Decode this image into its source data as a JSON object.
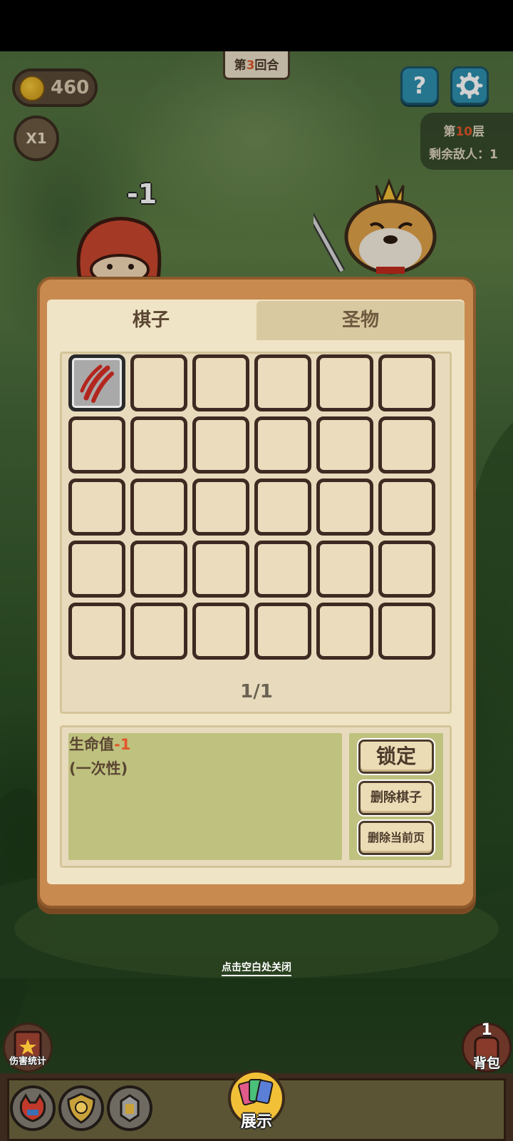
{
  "hud": {
    "round_prefix": "第",
    "round_number": "3",
    "round_suffix": "回合",
    "coins": "460",
    "speed": "X1",
    "floor_prefix": "第",
    "floor_number": "10",
    "floor_suffix": "层",
    "enemies_remaining": "剩余敌人：1"
  },
  "battle": {
    "damage_popup": "-1"
  },
  "inventory": {
    "tabs": [
      {
        "label": "棋子",
        "active": true
      },
      {
        "label": "圣物",
        "active": false
      }
    ],
    "grid": {
      "rows": 5,
      "cols": 6,
      "filled": [
        [
          0,
          0
        ]
      ]
    },
    "page_indicator": "1/1",
    "description": {
      "label": "生命值",
      "value": "-1",
      "note": "(一次性)"
    },
    "buttons": {
      "lock": "锁定",
      "delete_piece": "删除棋子",
      "delete_page": "删除当前页"
    }
  },
  "close_hint": "点击空白处关闭",
  "bottom": {
    "damage_stats": "伤害统计",
    "backpack_count": "1",
    "backpack": "背包",
    "show": "展示"
  },
  "colors": {
    "accent_orange": "#e0572a",
    "panel_wood": "#c98a4f",
    "teal_button": "#2e8fae"
  }
}
